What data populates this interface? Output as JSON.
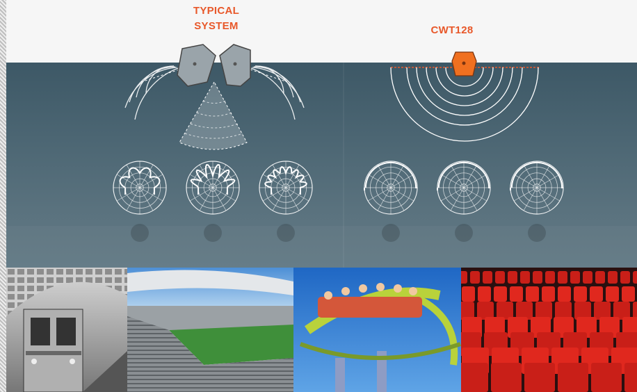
{
  "labels": {
    "typical": "TYPICAL SYSTEM",
    "cwt": "CWT128"
  },
  "colors": {
    "accent": "#e8582a",
    "panel": "#4d6774",
    "cwt_body": "#f07020"
  },
  "photos": [
    {
      "subject": "subway train in vaulted station"
    },
    {
      "subject": "stadium seating and pitch"
    },
    {
      "subject": "roller coaster with riders"
    },
    {
      "subject": "red theater seats"
    }
  ]
}
